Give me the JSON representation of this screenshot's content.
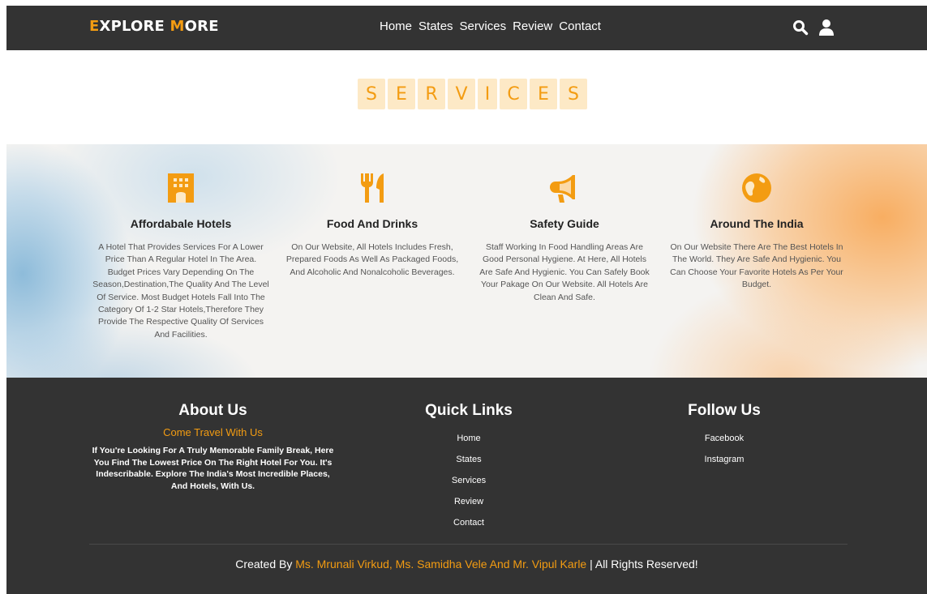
{
  "navbar": {
    "logo_e": "E",
    "logo_xplore": "XPLORE ",
    "logo_m": "M",
    "logo_ore": "ORE",
    "links": [
      "Home",
      "States",
      "Services",
      "Review",
      "Contact"
    ],
    "icons": [
      "search-icon",
      "user-icon"
    ]
  },
  "heading": {
    "letters": [
      "S",
      "E",
      "R",
      "V",
      "I",
      "C",
      "E",
      "S"
    ]
  },
  "colors": {
    "accent": "#f39c12",
    "dark": "#333333",
    "letter_bg": "#fde9c6"
  },
  "services": [
    {
      "icon": "hotel-icon",
      "title": "Affordabale Hotels",
      "text": "A Hotel That Provides Services For A Lower Price Than A Regular Hotel In The Area. Budget Prices Vary Depending On The Season,Destination,The Quality And The Level Of Service. Most Budget Hotels Fall Into The Category Of 1-2 Star Hotels,Therefore They Provide The Respective Quality Of Services And Facilities."
    },
    {
      "icon": "utensils-icon",
      "title": "Food And Drinks",
      "text": "On Our Website, All Hotels Includes Fresh, Prepared Foods As Well As Packaged Foods, And Alcoholic And Nonalcoholic Beverages."
    },
    {
      "icon": "bullhorn-icon",
      "title": "Safety Guide",
      "text": "Staff Working In Food Handling Areas Are Good Personal Hygiene. At Here, All Hotels Are Safe And Hygienic. You Can Safely Book Your Pakage On Our Website. All Hotels Are Clean And Safe."
    },
    {
      "icon": "globe-icon",
      "title": "Around The India",
      "text": "On Our Website There Are The Best Hotels In The World. They Are Safe And Hygienic. You Can Choose Your Favorite Hotels As Per Your Budget."
    }
  ],
  "footer": {
    "about": {
      "title": "About Us",
      "subtitle": "Come Travel With Us",
      "text": "If You're Looking For A Truly Memorable Family Break, Here You Find The Lowest Price On The Right Hotel For You. It's Indescribable. Explore The India's Most Incredible Places, And Hotels, With Us."
    },
    "quick_links": {
      "title": "Quick Links",
      "items": [
        "Home",
        "States",
        "Services",
        "Review",
        "Contact"
      ]
    },
    "follow": {
      "title": "Follow Us",
      "items": [
        "Facebook",
        "Instagram"
      ]
    },
    "credits": {
      "prefix": "Created By ",
      "names": "Ms. Mrunali Virkud, Ms. Samidha Vele And Mr. Vipul Karle",
      "suffix": " | All Rights Reserved!"
    }
  }
}
